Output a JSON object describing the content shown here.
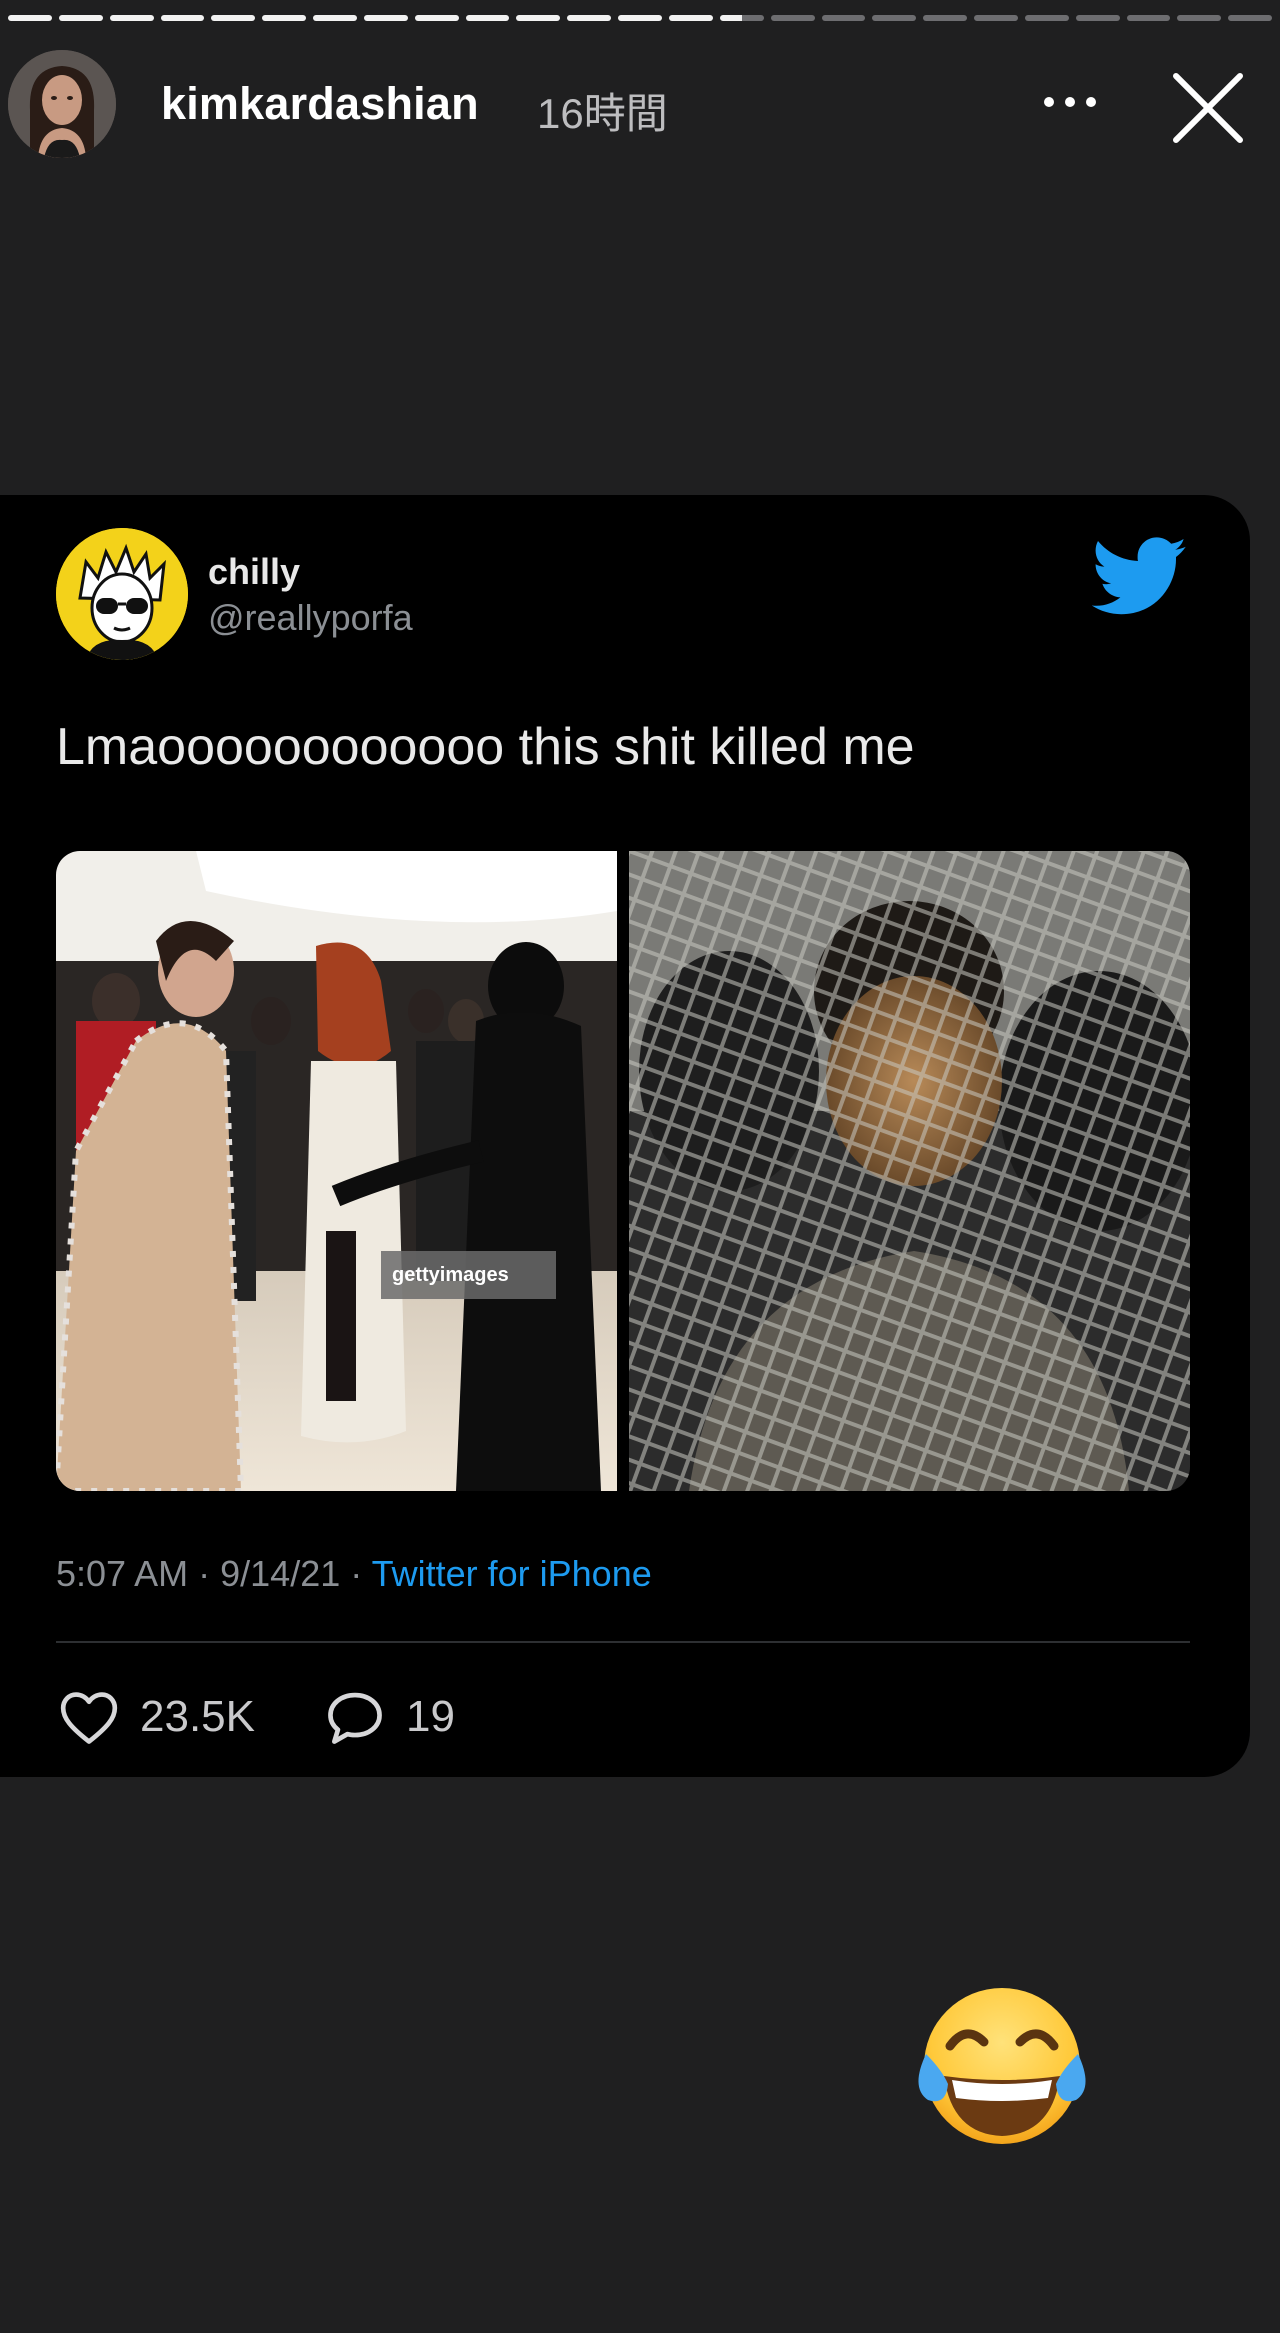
{
  "story": {
    "username": "kimkardashian",
    "time_ago": "16時間",
    "progress": {
      "segments_total": 25,
      "segments_viewed": 14,
      "current_segment_fill": 0.5
    }
  },
  "tweet": {
    "display_name": "chilly",
    "handle": "@reallyporfa",
    "text": "Lmaoooooooooooo this shit killed me",
    "image_watermark": "gettyimages",
    "time": "5:07 AM",
    "date": "9/14/21",
    "separator": "·",
    "source": "Twitter for iPhone",
    "likes": "23.5K",
    "replies": "19",
    "accent_color": "#1d9bf0"
  },
  "sticker": {
    "emoji_name": "face-with-tears-of-joy-icon"
  }
}
